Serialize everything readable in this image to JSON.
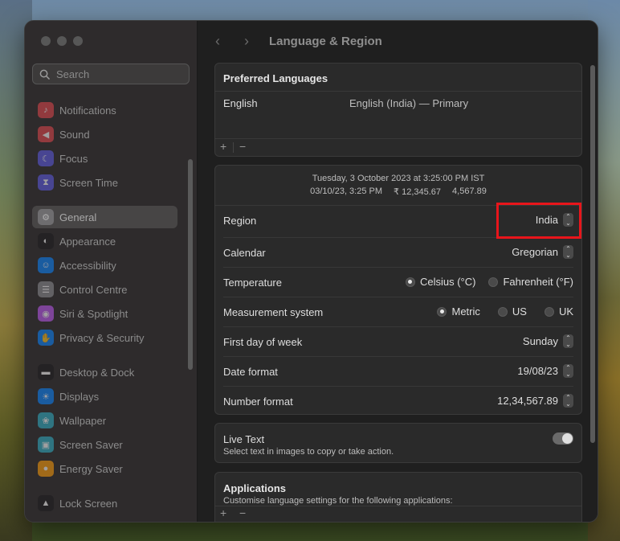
{
  "window": {
    "title": "Language & Region"
  },
  "search": {
    "placeholder": "Search"
  },
  "sidebar": {
    "items": [
      {
        "label": "Notifications",
        "icon": "bell-icon",
        "color": "#e5484d"
      },
      {
        "label": "Sound",
        "icon": "speaker-icon",
        "color": "#e5484d"
      },
      {
        "label": "Focus",
        "icon": "moon-icon",
        "color": "#5e5ce6"
      },
      {
        "label": "Screen Time",
        "icon": "hourglass-icon",
        "color": "#5e5ce6"
      },
      {
        "label": "General",
        "icon": "gear-icon",
        "color": "#8e8e93"
      },
      {
        "label": "Appearance",
        "icon": "appearance-icon",
        "color": "#1c1c1e"
      },
      {
        "label": "Accessibility",
        "icon": "accessibility-icon",
        "color": "#0a84ff"
      },
      {
        "label": "Control Centre",
        "icon": "control-centre-icon",
        "color": "#8e8e93"
      },
      {
        "label": "Siri & Spotlight",
        "icon": "siri-icon",
        "color": "#bf5af2"
      },
      {
        "label": "Privacy & Security",
        "icon": "hand-icon",
        "color": "#0a84ff"
      },
      {
        "label": "Desktop & Dock",
        "icon": "dock-icon",
        "color": "#1c1c1e"
      },
      {
        "label": "Displays",
        "icon": "sun-icon",
        "color": "#0a84ff"
      },
      {
        "label": "Wallpaper",
        "icon": "flower-icon",
        "color": "#30b0c7"
      },
      {
        "label": "Screen Saver",
        "icon": "screen-saver-icon",
        "color": "#30b0c7"
      },
      {
        "label": "Energy Saver",
        "icon": "bulb-icon",
        "color": "#ff9f0a"
      },
      {
        "label": "Lock Screen",
        "icon": "lock-icon",
        "color": "#1c1c1e"
      }
    ],
    "active": "General"
  },
  "preferred_languages": {
    "title": "Preferred Languages",
    "rows": [
      {
        "name": "English",
        "detail": "English (India) — Primary"
      }
    ],
    "add": "+",
    "remove": "−"
  },
  "preview": {
    "line1": "Tuesday, 3 October 2023 at 3:25:00 PM IST",
    "date_short": "03/10/23, 3:25 PM",
    "currency": "₹ 12,345.67",
    "number": "4,567.89"
  },
  "settings": {
    "region": {
      "label": "Region",
      "value": "India"
    },
    "calendar": {
      "label": "Calendar",
      "value": "Gregorian"
    },
    "temperature": {
      "label": "Temperature",
      "options": [
        "Celsius (°C)",
        "Fahrenheit (°F)"
      ],
      "selected": "Celsius (°C)"
    },
    "measurement": {
      "label": "Measurement system",
      "options": [
        "Metric",
        "US",
        "UK"
      ],
      "selected": "Metric"
    },
    "first_day": {
      "label": "First day of week",
      "value": "Sunday"
    },
    "date_format": {
      "label": "Date format",
      "value": "19/08/23"
    },
    "number_format": {
      "label": "Number format",
      "value": "12,34,567.89"
    }
  },
  "live_text": {
    "title": "Live Text",
    "description": "Select text in images to copy or take action.",
    "enabled": true
  },
  "applications": {
    "title": "Applications",
    "description": "Customise language settings for the following applications:",
    "add": "+",
    "remove": "−"
  },
  "colors": {
    "highlight": "#e8151b"
  }
}
